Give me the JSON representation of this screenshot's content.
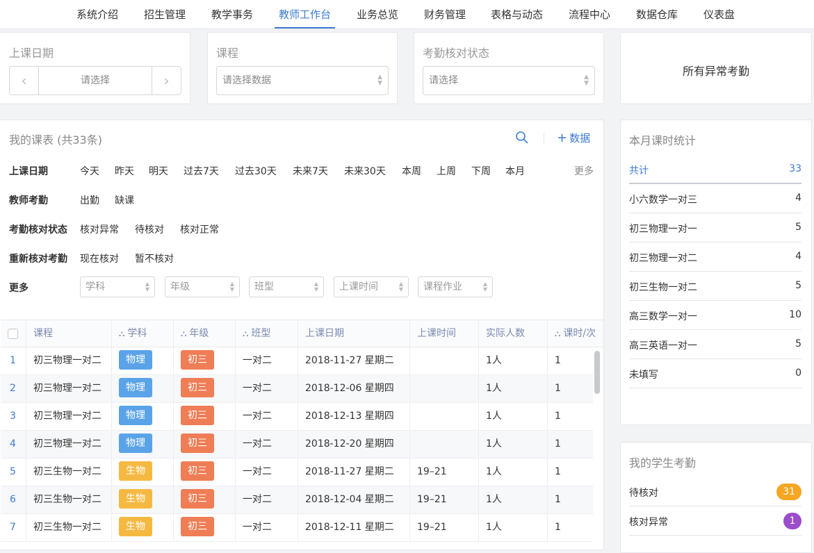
{
  "nav": {
    "items": [
      "系统介绍",
      "招生管理",
      "教学事务",
      "教师工作台",
      "业务总览",
      "财务管理",
      "表格与动态",
      "流程中心",
      "数据仓库",
      "仪表盘"
    ],
    "active": "教师工作台"
  },
  "filters": {
    "date": {
      "title": "上课日期",
      "placeholder": "请选择"
    },
    "course": {
      "title": "课程",
      "placeholder": "请选择数据"
    },
    "attendance_status": {
      "title": "考勤核对状态",
      "placeholder": "请选择"
    },
    "abnormal_label": "所有异常考勤"
  },
  "schedule": {
    "title": "我的课表 (共33条)",
    "add_label": "数据",
    "filter_rows": [
      {
        "label": "上课日期",
        "chips": [
          "今天",
          "昨天",
          "明天",
          "过去7天",
          "过去30天",
          "未来7天",
          "未来30天",
          "本周",
          "上周",
          "下周",
          "本月"
        ]
      },
      {
        "label": "教师考勤",
        "chips": [
          "出勤",
          "缺课"
        ]
      },
      {
        "label": "考勤核对状态",
        "chips": [
          "核对异常",
          "待核对",
          "核对正常"
        ]
      },
      {
        "label": "重新核对考勤",
        "chips": [
          "现在核对",
          "暂不核对"
        ]
      },
      {
        "label": "更多",
        "chips": []
      }
    ],
    "more_label": "更多",
    "more_selects": [
      "学科",
      "年级",
      "班型",
      "上课时间",
      "课程作业"
    ],
    "columns": [
      "课程",
      "学科",
      "年级",
      "班型",
      "上课日期",
      "上课时间",
      "实际人数",
      "课时/次"
    ],
    "rows": [
      {
        "idx": "1",
        "course": "初三物理一对二",
        "subject": "物理",
        "grade": "初三",
        "class_type": "一对二",
        "date": "2018-11-27 星期二",
        "time": "",
        "count": "1人",
        "hours": "1"
      },
      {
        "idx": "2",
        "course": "初三物理一对二",
        "subject": "物理",
        "grade": "初三",
        "class_type": "一对二",
        "date": "2018-12-06 星期四",
        "time": "",
        "count": "1人",
        "hours": "1"
      },
      {
        "idx": "3",
        "course": "初三物理一对二",
        "subject": "物理",
        "grade": "初三",
        "class_type": "一对二",
        "date": "2018-12-13 星期四",
        "time": "",
        "count": "1人",
        "hours": "1"
      },
      {
        "idx": "4",
        "course": "初三物理一对二",
        "subject": "物理",
        "grade": "初三",
        "class_type": "一对二",
        "date": "2018-12-20 星期四",
        "time": "",
        "count": "1人",
        "hours": "1"
      },
      {
        "idx": "5",
        "course": "初三生物一对二",
        "subject": "生物",
        "grade": "初三",
        "class_type": "一对二",
        "date": "2018-11-27 星期二",
        "time": "19–21",
        "count": "1人",
        "hours": "1"
      },
      {
        "idx": "6",
        "course": "初三生物一对二",
        "subject": "生物",
        "grade": "初三",
        "class_type": "一对二",
        "date": "2018-12-04 星期二",
        "time": "19–21",
        "count": "1人",
        "hours": "1"
      },
      {
        "idx": "7",
        "course": "初三生物一对二",
        "subject": "生物",
        "grade": "初三",
        "class_type": "一对二",
        "date": "2018-12-11 星期二",
        "time": "19–21",
        "count": "1人",
        "hours": "1"
      }
    ]
  },
  "tag_colors": {
    "物理": "#5aa3e8",
    "生物": "#f5b942",
    "初三": "#ef7d55"
  },
  "monthly_stats": {
    "title": "本月课时统计",
    "total": {
      "name": "共计",
      "value": "33"
    },
    "items": [
      {
        "name": "小六数学一对三",
        "value": "4"
      },
      {
        "name": "初三物理一对一",
        "value": "5"
      },
      {
        "name": "初三物理一对二",
        "value": "4"
      },
      {
        "name": "初三生物一对二",
        "value": "5"
      },
      {
        "name": "高三数学一对一",
        "value": "10"
      },
      {
        "name": "高三英语一对一",
        "value": "5"
      },
      {
        "name": "未填写",
        "value": "0"
      }
    ]
  },
  "student_attendance": {
    "title": "我的学生考勤",
    "items": [
      {
        "name": "待核对",
        "count": "31",
        "color": "#f5a623"
      },
      {
        "name": "核对异常",
        "count": "1",
        "color": "#9b4dca"
      }
    ]
  }
}
